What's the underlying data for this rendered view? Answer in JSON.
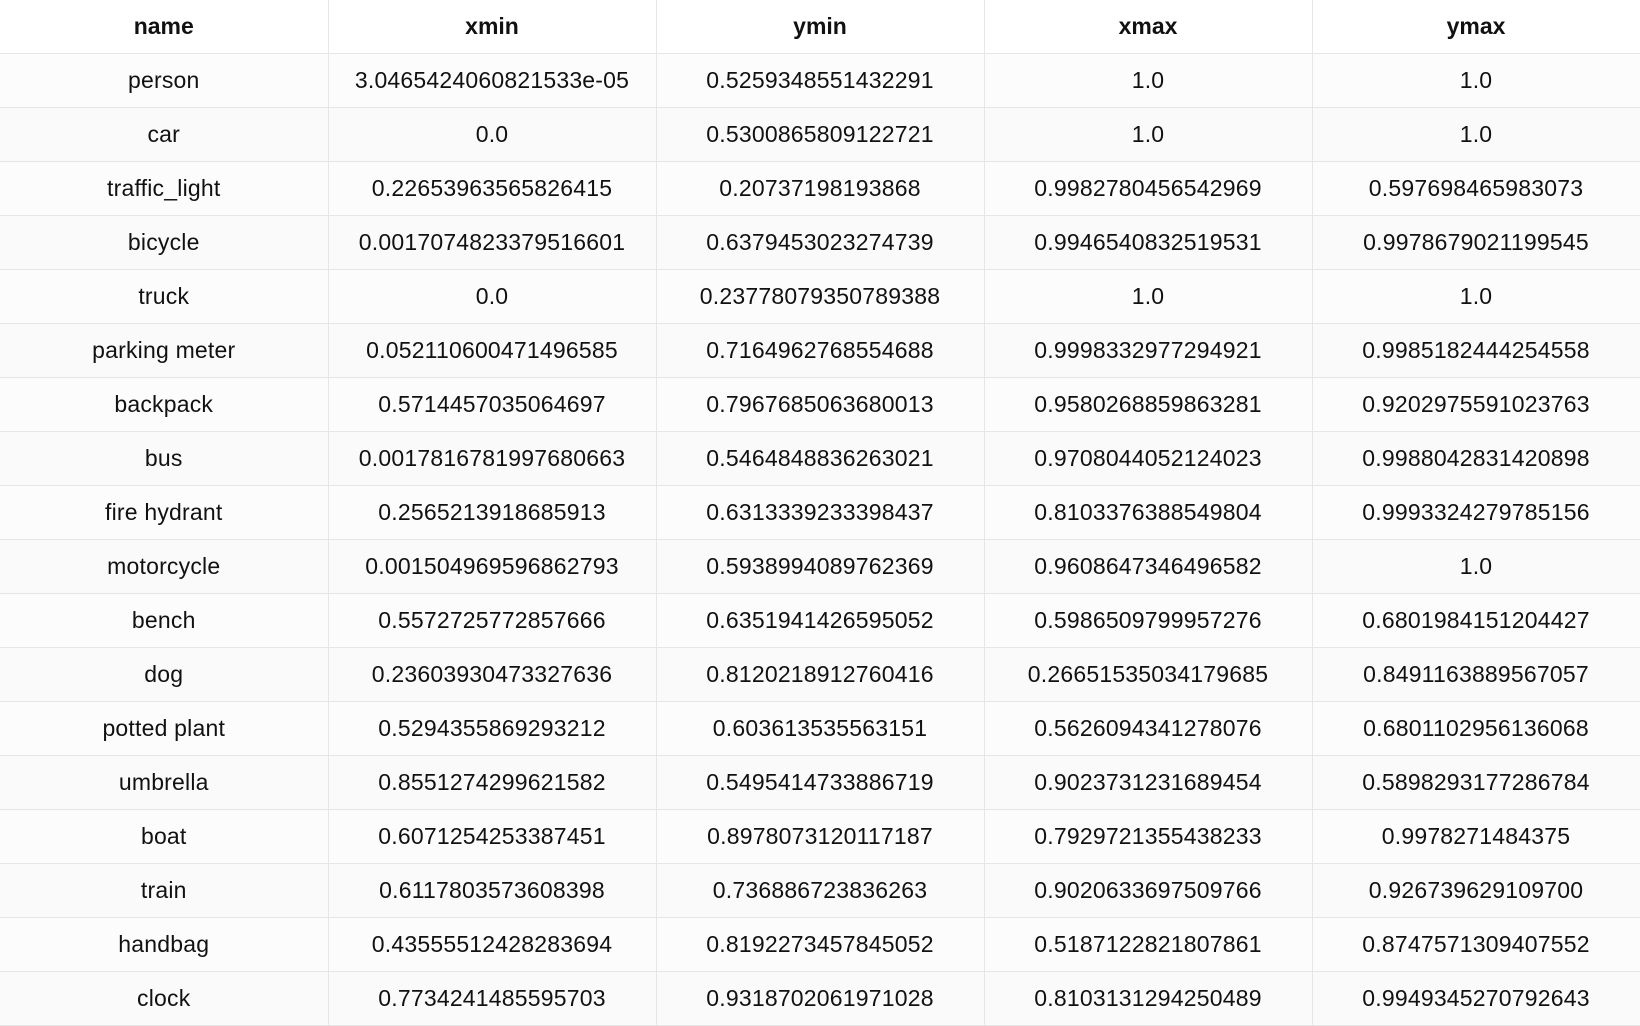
{
  "table": {
    "columns": [
      "name",
      "xmin",
      "ymin",
      "xmax",
      "ymax"
    ],
    "rows": [
      [
        "person",
        "3.0465424060821533e-05",
        "0.5259348551432291",
        "1.0",
        "1.0"
      ],
      [
        "car",
        "0.0",
        "0.5300865809122721",
        "1.0",
        "1.0"
      ],
      [
        "traffic_light",
        "0.22653963565826415",
        "0.20737198193868",
        "0.9982780456542969",
        "0.597698465983073"
      ],
      [
        "bicycle",
        "0.0017074823379516601",
        "0.6379453023274739",
        "0.9946540832519531",
        "0.9978679021199545"
      ],
      [
        "truck",
        "0.0",
        "0.23778079350789388",
        "1.0",
        "1.0"
      ],
      [
        "parking meter",
        "0.052110600471496585",
        "0.7164962768554688",
        "0.9998332977294921",
        "0.9985182444254558"
      ],
      [
        "backpack",
        "0.5714457035064697",
        "0.7967685063680013",
        "0.9580268859863281",
        "0.9202975591023763"
      ],
      [
        "bus",
        "0.0017816781997680663",
        "0.5464848836263021",
        "0.9708044052124023",
        "0.9988042831420898"
      ],
      [
        "fire hydrant",
        "0.2565213918685913",
        "0.6313339233398437",
        "0.8103376388549804",
        "0.9993324279785156"
      ],
      [
        "motorcycle",
        "0.001504969596862793",
        "0.5938994089762369",
        "0.9608647346496582",
        "1.0"
      ],
      [
        "bench",
        "0.5572725772857666",
        "0.6351941426595052",
        "0.5986509799957276",
        "0.6801984151204427"
      ],
      [
        "dog",
        "0.23603930473327636",
        "0.8120218912760416",
        "0.26651535034179685",
        "0.8491163889567057"
      ],
      [
        "potted plant",
        "0.5294355869293212",
        "0.603613535563151",
        "0.5626094341278076",
        "0.6801102956136068"
      ],
      [
        "umbrella",
        "0.8551274299621582",
        "0.5495414733886719",
        "0.9023731231689454",
        "0.5898293177286784"
      ],
      [
        "boat",
        "0.6071254253387451",
        "0.8978073120117187",
        "0.7929721355438233",
        "0.9978271484375"
      ],
      [
        "train",
        "0.6117803573608398",
        "0.736886723836263",
        "0.9020633697509766",
        "0.926739629109700"
      ],
      [
        "handbag",
        "0.43555512428283694",
        "0.8192273457845052",
        "0.5187122821807861",
        "0.8747571309407552"
      ],
      [
        "clock",
        "0.7734241485595703",
        "0.9318702061971028",
        "0.8103131294250489",
        "0.9949345270792643"
      ]
    ]
  }
}
